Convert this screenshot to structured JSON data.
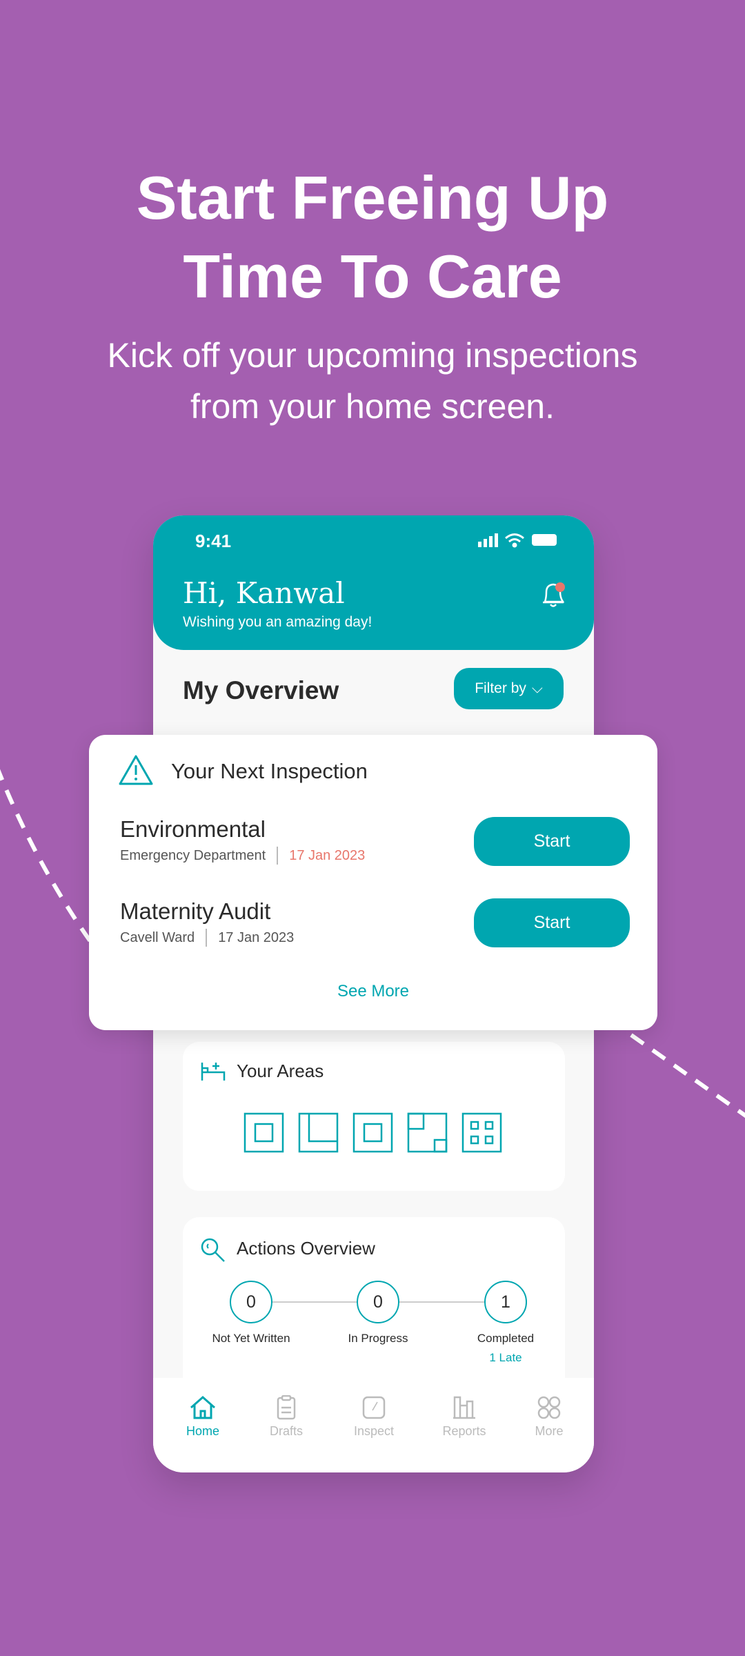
{
  "promo": {
    "headline_1": "Start Freeing Up",
    "headline_2": "Time To Care",
    "subtitle_1": "Kick off your upcoming inspections",
    "subtitle_2": "from your home screen."
  },
  "status_bar": {
    "time": "9:41"
  },
  "header": {
    "greeting": "Hi, Kanwal",
    "subtitle": "Wishing you an amazing day!"
  },
  "overview": {
    "title": "My Overview",
    "filter_label": "Filter by"
  },
  "next_inspection": {
    "title": "Your Next Inspection",
    "items": [
      {
        "name": "Environmental",
        "location": "Emergency Department",
        "date": "17 Jan 2023",
        "date_color": "#e8766b",
        "button": "Start"
      },
      {
        "name": "Maternity Audit",
        "location": "Cavell Ward",
        "date": "17 Jan 2023",
        "date_color": "#555555",
        "button": "Start"
      }
    ],
    "see_more": "See More"
  },
  "areas": {
    "title": "Your Areas"
  },
  "actions": {
    "title": "Actions Overview",
    "stats": [
      {
        "value": "0",
        "label": "Not Yet Written"
      },
      {
        "value": "0",
        "label": "In Progress"
      },
      {
        "value": "1",
        "label": "Completed",
        "note": "1 Late"
      }
    ]
  },
  "nav": {
    "items": [
      {
        "label": "Home",
        "active": true
      },
      {
        "label": "Drafts"
      },
      {
        "label": "Inspect"
      },
      {
        "label": "Reports"
      },
      {
        "label": "More"
      }
    ]
  },
  "colors": {
    "background": "#a45fb0",
    "accent": "#00a6b0",
    "alert": "#e8766b"
  }
}
